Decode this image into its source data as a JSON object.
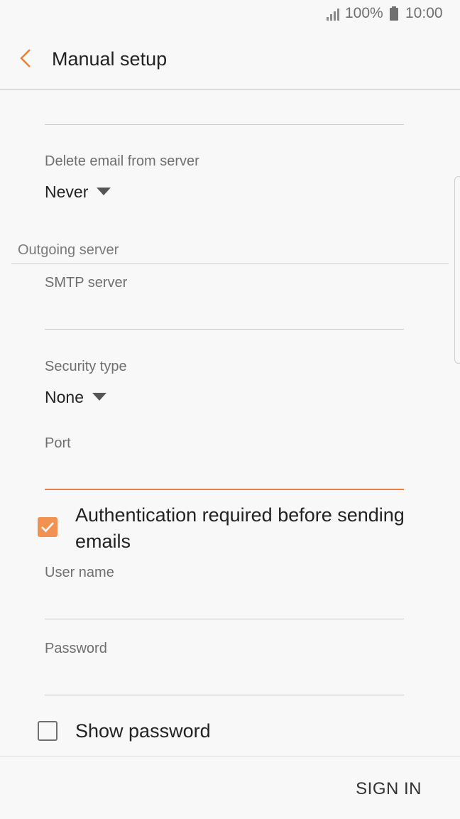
{
  "status": {
    "battery": "100%",
    "time": "10:00"
  },
  "header": {
    "title": "Manual setup"
  },
  "incoming": {
    "delete_label": "Delete email from server",
    "delete_value": "Never"
  },
  "outgoing": {
    "section_title": "Outgoing server",
    "smtp_label": "SMTP server",
    "smtp_value": "",
    "security_label": "Security type",
    "security_value": "None",
    "port_label": "Port",
    "port_value": ""
  },
  "auth": {
    "checkbox_label": "Authentication required before sending emails",
    "checked": true,
    "username_label": "User name",
    "username_value": "",
    "password_label": "Password",
    "password_value": ""
  },
  "show_password": {
    "label": "Show password",
    "checked": false
  },
  "footer": {
    "sign_in": "SIGN IN"
  },
  "colors": {
    "accent": "#ef7f3c",
    "checkbox_fill": "#f39150",
    "background": "#f8f8f8"
  }
}
